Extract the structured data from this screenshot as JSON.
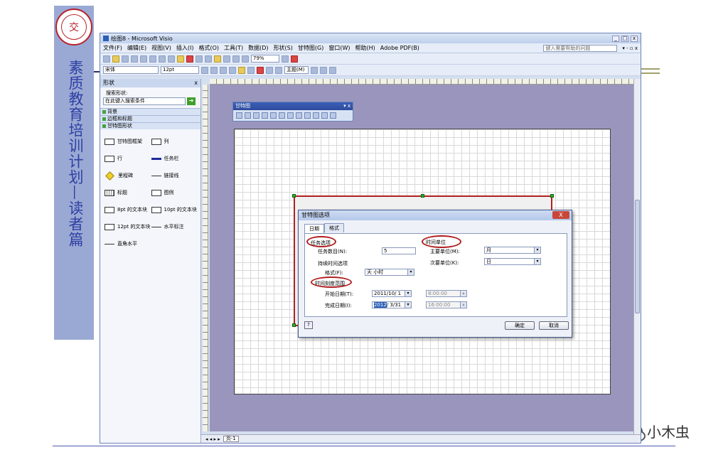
{
  "slide": {
    "logo_char": "交",
    "vertical_title": "素质教育培训计划—读者篇",
    "watermark": "小木虫"
  },
  "window": {
    "title": "绘图8 - Microsoft Visio",
    "menus": [
      "文件(F)",
      "编辑(E)",
      "视图(V)",
      "插入(I)",
      "格式(O)",
      "工具(T)",
      "数据(D)",
      "形状(S)",
      "甘特图(G)",
      "窗口(W)",
      "帮助(H)",
      "Adobe PDF(B)"
    ],
    "help_placeholder": "键入需要帮助的问题",
    "zoom": "79%",
    "font_name": "宋体",
    "font_size": "12pt",
    "theme_label": "主题(M)"
  },
  "shapes_panel": {
    "title": "形状",
    "search_label": "搜索形状:",
    "search_placeholder": "在此键入搜索条件",
    "stencils": [
      "背景",
      "边框和标题",
      "甘特图形状"
    ],
    "items": [
      {
        "label": "甘特图框架",
        "icon": "gantt-frame-icon",
        "kind": "box"
      },
      {
        "label": "列",
        "icon": "column-icon",
        "kind": "box"
      },
      {
        "label": "行",
        "icon": "row-icon",
        "kind": "box"
      },
      {
        "label": "任务栏",
        "icon": "task-bar-icon",
        "kind": "bar"
      },
      {
        "label": "里程碑",
        "icon": "milestone-icon",
        "kind": "dia"
      },
      {
        "label": "链接线",
        "icon": "link-line-icon",
        "kind": "line"
      },
      {
        "label": "标题",
        "icon": "title-icon",
        "kind": "grid"
      },
      {
        "label": "图例",
        "icon": "legend-icon",
        "kind": "box"
      },
      {
        "label": "8pt 的文本块",
        "icon": "text-block-icon",
        "kind": "box"
      },
      {
        "label": "10pt 的文本块",
        "icon": "text-block-icon",
        "kind": "box"
      },
      {
        "label": "12pt 的文本块",
        "icon": "text-block-icon",
        "kind": "box"
      },
      {
        "label": "水平标注",
        "icon": "callout-icon",
        "kind": "line"
      },
      {
        "label": "直角水平",
        "icon": "right-angle-icon",
        "kind": "line"
      }
    ]
  },
  "gantt_toolbar": {
    "title": "甘特图"
  },
  "page_tab": "页-1",
  "dialog": {
    "title": "甘特图选项",
    "close": "X",
    "tabs": [
      "日期",
      "格式"
    ],
    "task_options_label": "任务选项",
    "task_count_label": "任务数目(N):",
    "task_count_value": "5",
    "duration_options_label": "持续时间选项",
    "format_label": "格式(F):",
    "format_value": "天 小时",
    "time_unit_label": "时间单位",
    "major_unit_label": "主要单位(M):",
    "major_unit_value": "月",
    "minor_unit_label": "次要单位(K):",
    "minor_unit_value": "日",
    "time_range_label": "时间刻度范围",
    "start_date_label": "开始日期(T):",
    "start_date_value": "2011/10/ 1",
    "start_time_value": "8:00:00",
    "finish_date_label": "完成日期(I):",
    "finish_date_year": "2012",
    "finish_date_rest": "/ 3/31",
    "finish_time_value": "16:00:00",
    "ok": "确定",
    "cancel": "取消"
  }
}
